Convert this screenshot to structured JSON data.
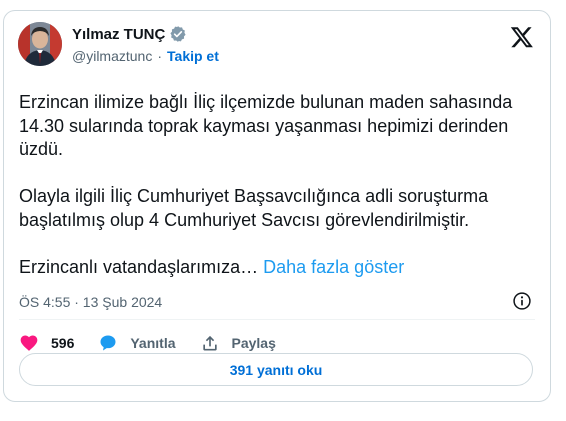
{
  "author": {
    "name": "Yılmaz TUNÇ",
    "handle": "@yilmaztunc",
    "separator": "·",
    "follow_label": "Takip et"
  },
  "tweet": {
    "paragraphs": [
      "Erzincan ilimize bağlı İliç ilçemizde bulunan maden sahasında 14.30 sularında toprak kayması yaşanması hepimizi derinden üzdü.",
      "Olayla ilgili İliç Cumhuriyet Başsavcılığınca adli soruşturma başlatılmış olup 4 Cumhuriyet Savcısı görevlendirilmiştir."
    ],
    "truncated_text": "Erzincanlı vatandaşlarımıza…",
    "show_more_label": "Daha fazla göster",
    "timestamp": "ÖS 4:55 · 13 Şub 2024"
  },
  "actions": {
    "like_count": "596",
    "reply_label": "Yanıtla",
    "share_label": "Paylaş"
  },
  "replies_button_label": "391 yanıtı oku",
  "icons": {
    "verified": "verified-badge-icon",
    "logo": "x-logo-icon",
    "info": "info-icon",
    "like": "heart-icon",
    "reply": "speech-bubble-icon",
    "share": "share-upload-icon"
  },
  "colors": {
    "accent": "#1d9bf0",
    "link": "#006fd6",
    "like": "#f91880",
    "text": "#0f1419",
    "muted": "#536471",
    "border": "#cfd9de"
  }
}
